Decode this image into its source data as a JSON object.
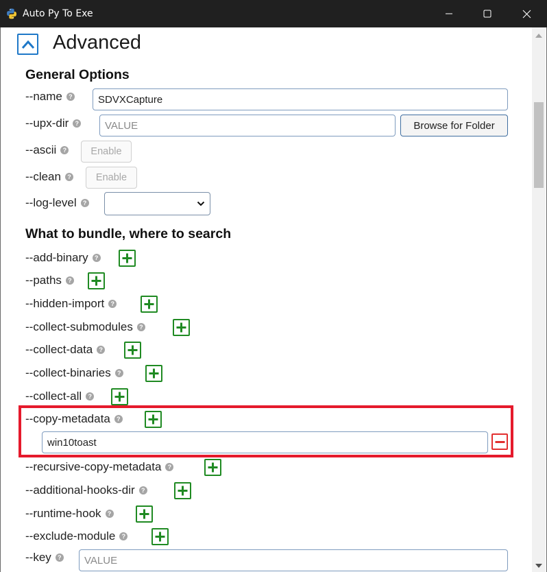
{
  "window": {
    "title": "Auto Py To Exe",
    "icons": {
      "app": "python-icon",
      "minimize": "minimize-icon",
      "maximize": "maximize-icon",
      "close": "close-icon"
    }
  },
  "advanced": {
    "title": "Advanced",
    "toggle_icon": "chevron-up-icon"
  },
  "general": {
    "title": "General Options",
    "name": {
      "label": "--name",
      "value": "SDVXCapture"
    },
    "upx_dir": {
      "label": "--upx-dir",
      "placeholder": "VALUE",
      "browse_label": "Browse for Folder"
    },
    "ascii": {
      "label": "--ascii",
      "button": "Enable"
    },
    "clean": {
      "label": "--clean",
      "button": "Enable"
    },
    "log_level": {
      "label": "--log-level",
      "selected": ""
    },
    "help_glyph": "?"
  },
  "bundle": {
    "title": "What to bundle, where to search",
    "items": [
      {
        "label": "--add-binary"
      },
      {
        "label": "--paths"
      },
      {
        "label": "--hidden-import"
      },
      {
        "label": "--collect-submodules"
      },
      {
        "label": "--collect-data"
      },
      {
        "label": "--collect-binaries"
      },
      {
        "label": "--collect-all"
      },
      {
        "label": "--copy-metadata",
        "entries": [
          "win10toast"
        ]
      },
      {
        "label": "--recursive-copy-metadata"
      },
      {
        "label": "--additional-hooks-dir"
      },
      {
        "label": "--runtime-hook"
      },
      {
        "label": "--exclude-module"
      }
    ],
    "key": {
      "label": "--key",
      "placeholder": "VALUE"
    }
  },
  "colors": {
    "accent_blue": "#1e78c8",
    "add_green": "#1f8a22",
    "remove_red": "#e22f2f",
    "highlight_red": "#e51a2c",
    "titlebar": "#202020"
  }
}
